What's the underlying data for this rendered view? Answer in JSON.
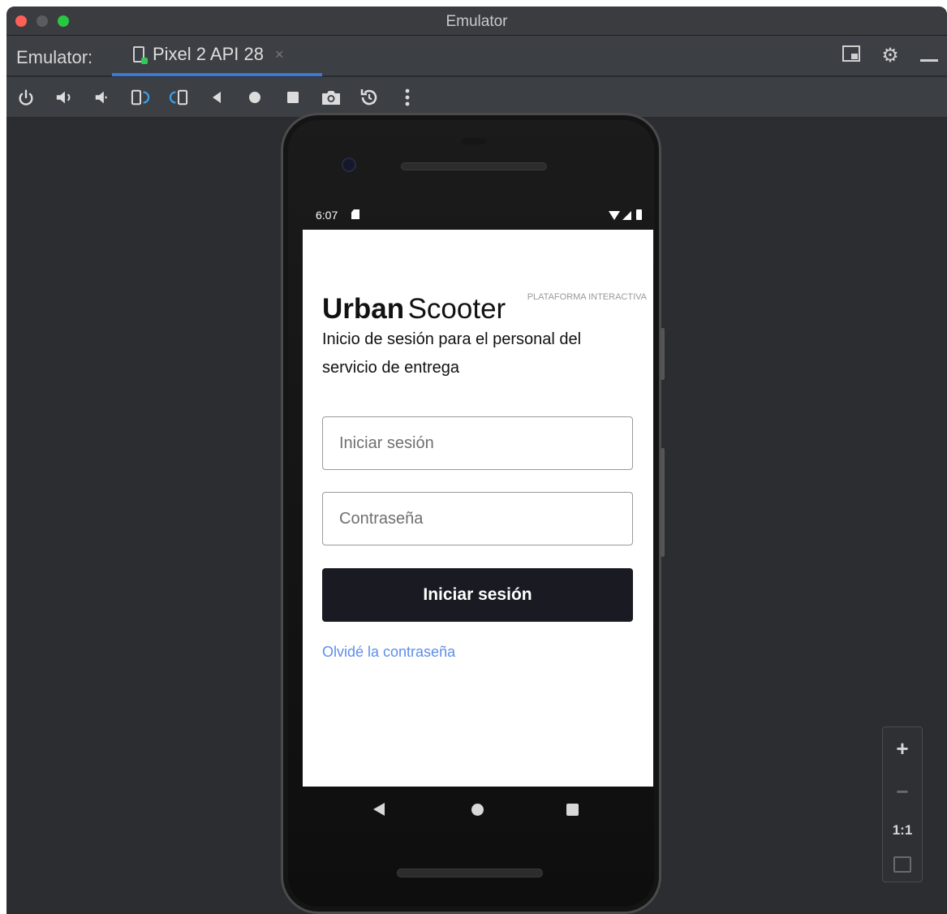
{
  "window": {
    "title": "Emulator"
  },
  "tabbar": {
    "label": "Emulator:",
    "device_tab": {
      "label": "Pixel 2 API 28",
      "close": "×"
    }
  },
  "toolbar": {
    "tools": [
      "power-icon",
      "volume-up-icon",
      "volume-down-icon",
      "rotate-left-icon",
      "rotate-right-icon",
      "back-icon",
      "home-icon",
      "overview-icon",
      "screenshot-icon",
      "snapshot-icon",
      "more-icon"
    ]
  },
  "device": {
    "status": {
      "time": "6:07"
    },
    "app": {
      "brand_bold": "Urban",
      "brand_light": "Scooter",
      "platform_tag": "PLATAFORMA INTERACTIVA",
      "subtitle": "Inicio de sesión para el personal del servicio de entrega",
      "login_placeholder": "Iniciar sesión",
      "password_placeholder": "Contraseña",
      "login_button": "Iniciar sesión",
      "forgot_link": "Olvidé la contraseña"
    }
  },
  "zoom_panel": {
    "zoom_in": "+",
    "zoom_out": "−",
    "actual_size": "1:1"
  },
  "colors": {
    "accent": "#3d7ad6",
    "button_dark": "#1a1b22",
    "link": "#5d8ee8"
  }
}
